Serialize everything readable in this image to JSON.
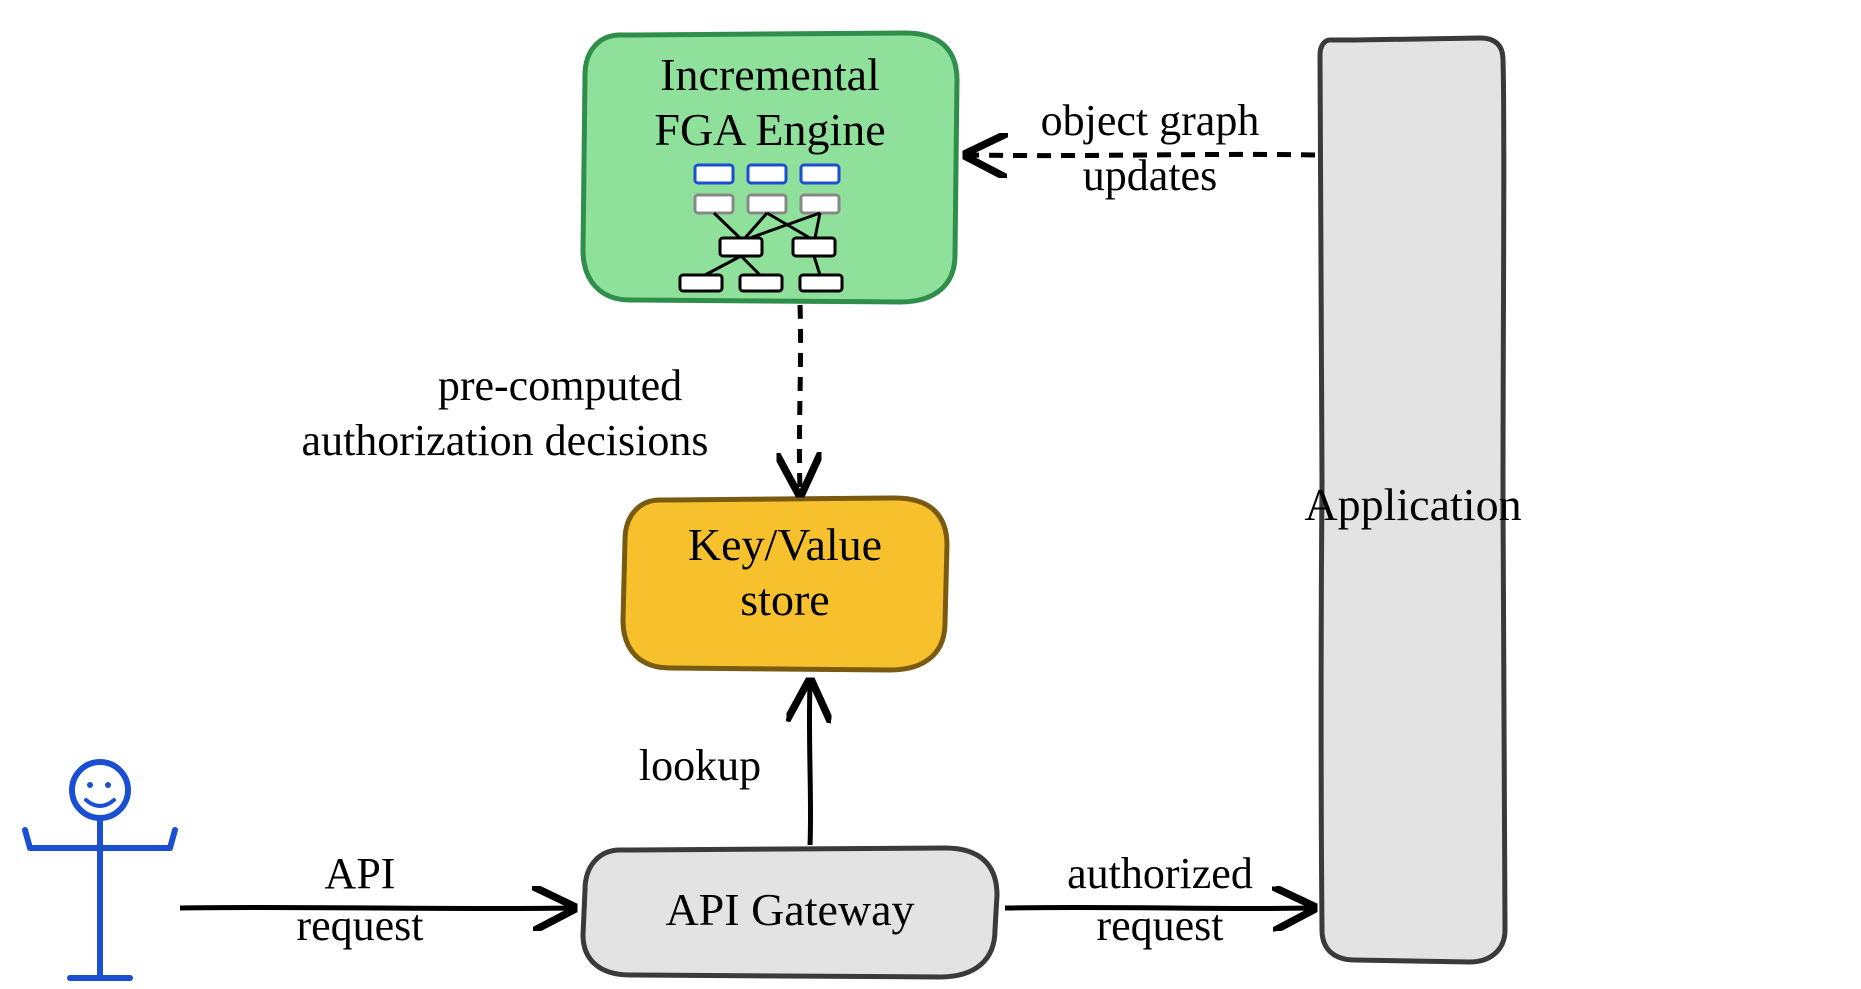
{
  "nodes": {
    "fga_engine": {
      "line1": "Incremental",
      "line2": "FGA Engine"
    },
    "kv_store": {
      "line1": "Key/Value",
      "line2": "store"
    },
    "api_gateway": {
      "label": "API Gateway"
    },
    "application": {
      "label": "Application"
    }
  },
  "edges": {
    "api_request": {
      "line1": "API",
      "line2": "request"
    },
    "lookup": {
      "label": "lookup"
    },
    "precomputed": {
      "line1": "pre-computed",
      "line2": "authorization decisions"
    },
    "authorized_request": {
      "line1": "authorized",
      "line2": "request"
    },
    "object_graph": {
      "line1": "object graph",
      "line2": "updates"
    }
  },
  "colors": {
    "fga_fill": "#8ee09a",
    "fga_stroke": "#2f8f4a",
    "kv_fill": "#f6c12c",
    "kv_stroke": "#7a5a10",
    "grey_fill": "#e3e3e3",
    "grey_stroke": "#3a3a3a",
    "person_stroke": "#1a4fd1",
    "ink": "#000000"
  }
}
